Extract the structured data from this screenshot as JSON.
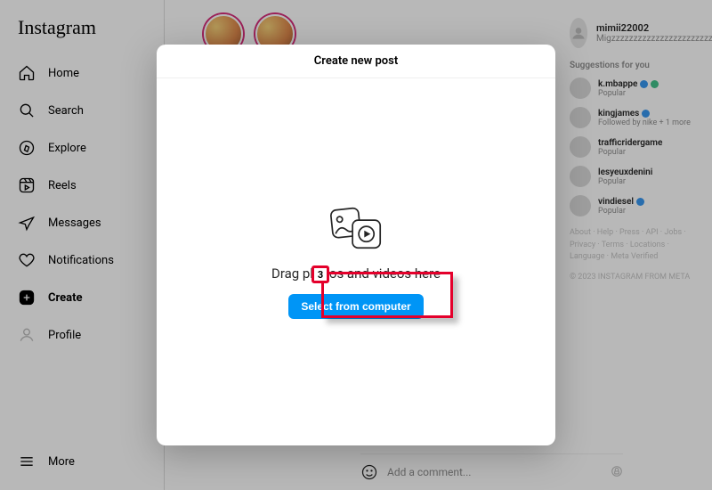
{
  "sidebar": {
    "logo": "Instagram",
    "items": [
      {
        "label": "Home"
      },
      {
        "label": "Search"
      },
      {
        "label": "Explore"
      },
      {
        "label": "Reels"
      },
      {
        "label": "Messages"
      },
      {
        "label": "Notifications"
      },
      {
        "label": "Create"
      },
      {
        "label": "Profile"
      }
    ],
    "more": "More"
  },
  "profile": {
    "username": "mimii22002",
    "subtitle": "Migzzzzzzzzzzzzzzzzzzzzzzzzzzzz"
  },
  "suggestions": {
    "heading": "Suggestions for you",
    "items": [
      {
        "name": "k.mbappe",
        "sub": "Popular",
        "verified": true,
        "green": true
      },
      {
        "name": "kingjames",
        "sub": "Followed by nike + 1 more",
        "verified": true
      },
      {
        "name": "trafficridergame",
        "sub": "Popular"
      },
      {
        "name": "lesyeuxdenini",
        "sub": "Popular"
      },
      {
        "name": "vindiesel",
        "sub": "Popular",
        "verified": true
      }
    ]
  },
  "footer": {
    "links": "About · Help · Press · API · Jobs · Privacy · Terms · Locations · Language · Meta Verified",
    "copyright": "© 2023 INSTAGRAM FROM META"
  },
  "comment": {
    "placeholder": "Add a comment..."
  },
  "modal": {
    "title": "Create new post",
    "drag_text": "Drag photos and videos here",
    "select_button": "Select from computer"
  },
  "annotation": {
    "number": "3"
  }
}
